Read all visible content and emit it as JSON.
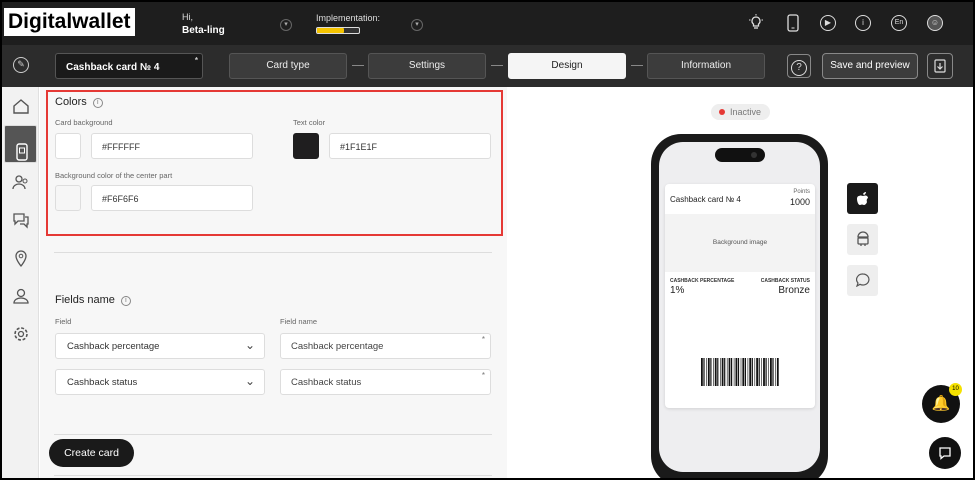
{
  "app": {
    "logo_text": "Digitalwallet"
  },
  "header": {
    "greeting": "Hi,",
    "user_name": "Beta-ling",
    "implementation_label": "Implementation:",
    "implementation_progress": 0.65,
    "lang": "En",
    "icons": [
      "bulb-icon",
      "phone-icon",
      "play-icon",
      "info-icon",
      "language-icon",
      "avatar-icon"
    ]
  },
  "toolbar": {
    "card_name": "Cashback card № 4",
    "card_name_required": "*",
    "steps": [
      "Card type",
      "Settings",
      "Design",
      "Information"
    ],
    "active_step": "Design",
    "help_label": "?",
    "save_label": "Save and preview"
  },
  "sidebar": {
    "items": [
      "home-icon",
      "card-icon",
      "users-icon",
      "messages-icon",
      "location-icon",
      "user-settings-icon",
      "settings-icon"
    ],
    "active": "card-icon"
  },
  "colors": {
    "title": "Colors",
    "info": "i",
    "card_bg_label": "Card background",
    "card_bg_value": "#FFFFFF",
    "text_color_label": "Text color",
    "text_color_value": "#1F1E1F",
    "center_bg_label": "Background color of the center part",
    "center_bg_value": "#F6F6F6",
    "highlight_color": "#e53935"
  },
  "fields": {
    "title": "Fields name",
    "info": "i",
    "field_label": "Field",
    "field_name_label": "Field name",
    "rows": [
      {
        "field": "Cashback percentage",
        "name": "Cashback percentage",
        "required": "*"
      },
      {
        "field": "Cashback status",
        "name": "Cashback status",
        "required": "*"
      }
    ]
  },
  "create_button": "Create card",
  "preview": {
    "status": "Inactive",
    "card_title": "Cashback card № 4",
    "points_label": "Points",
    "points_value": "1000",
    "background_image_label": "Background image",
    "field1_label": "CASHBACK PERCENTAGE",
    "field1_value": "1%",
    "field2_label": "CASHBACK STATUS",
    "field2_value": "Bronze",
    "platforms": [
      "apple-icon",
      "android-icon",
      "chat-bubble-icon"
    ]
  },
  "notifications": {
    "count": "10"
  }
}
